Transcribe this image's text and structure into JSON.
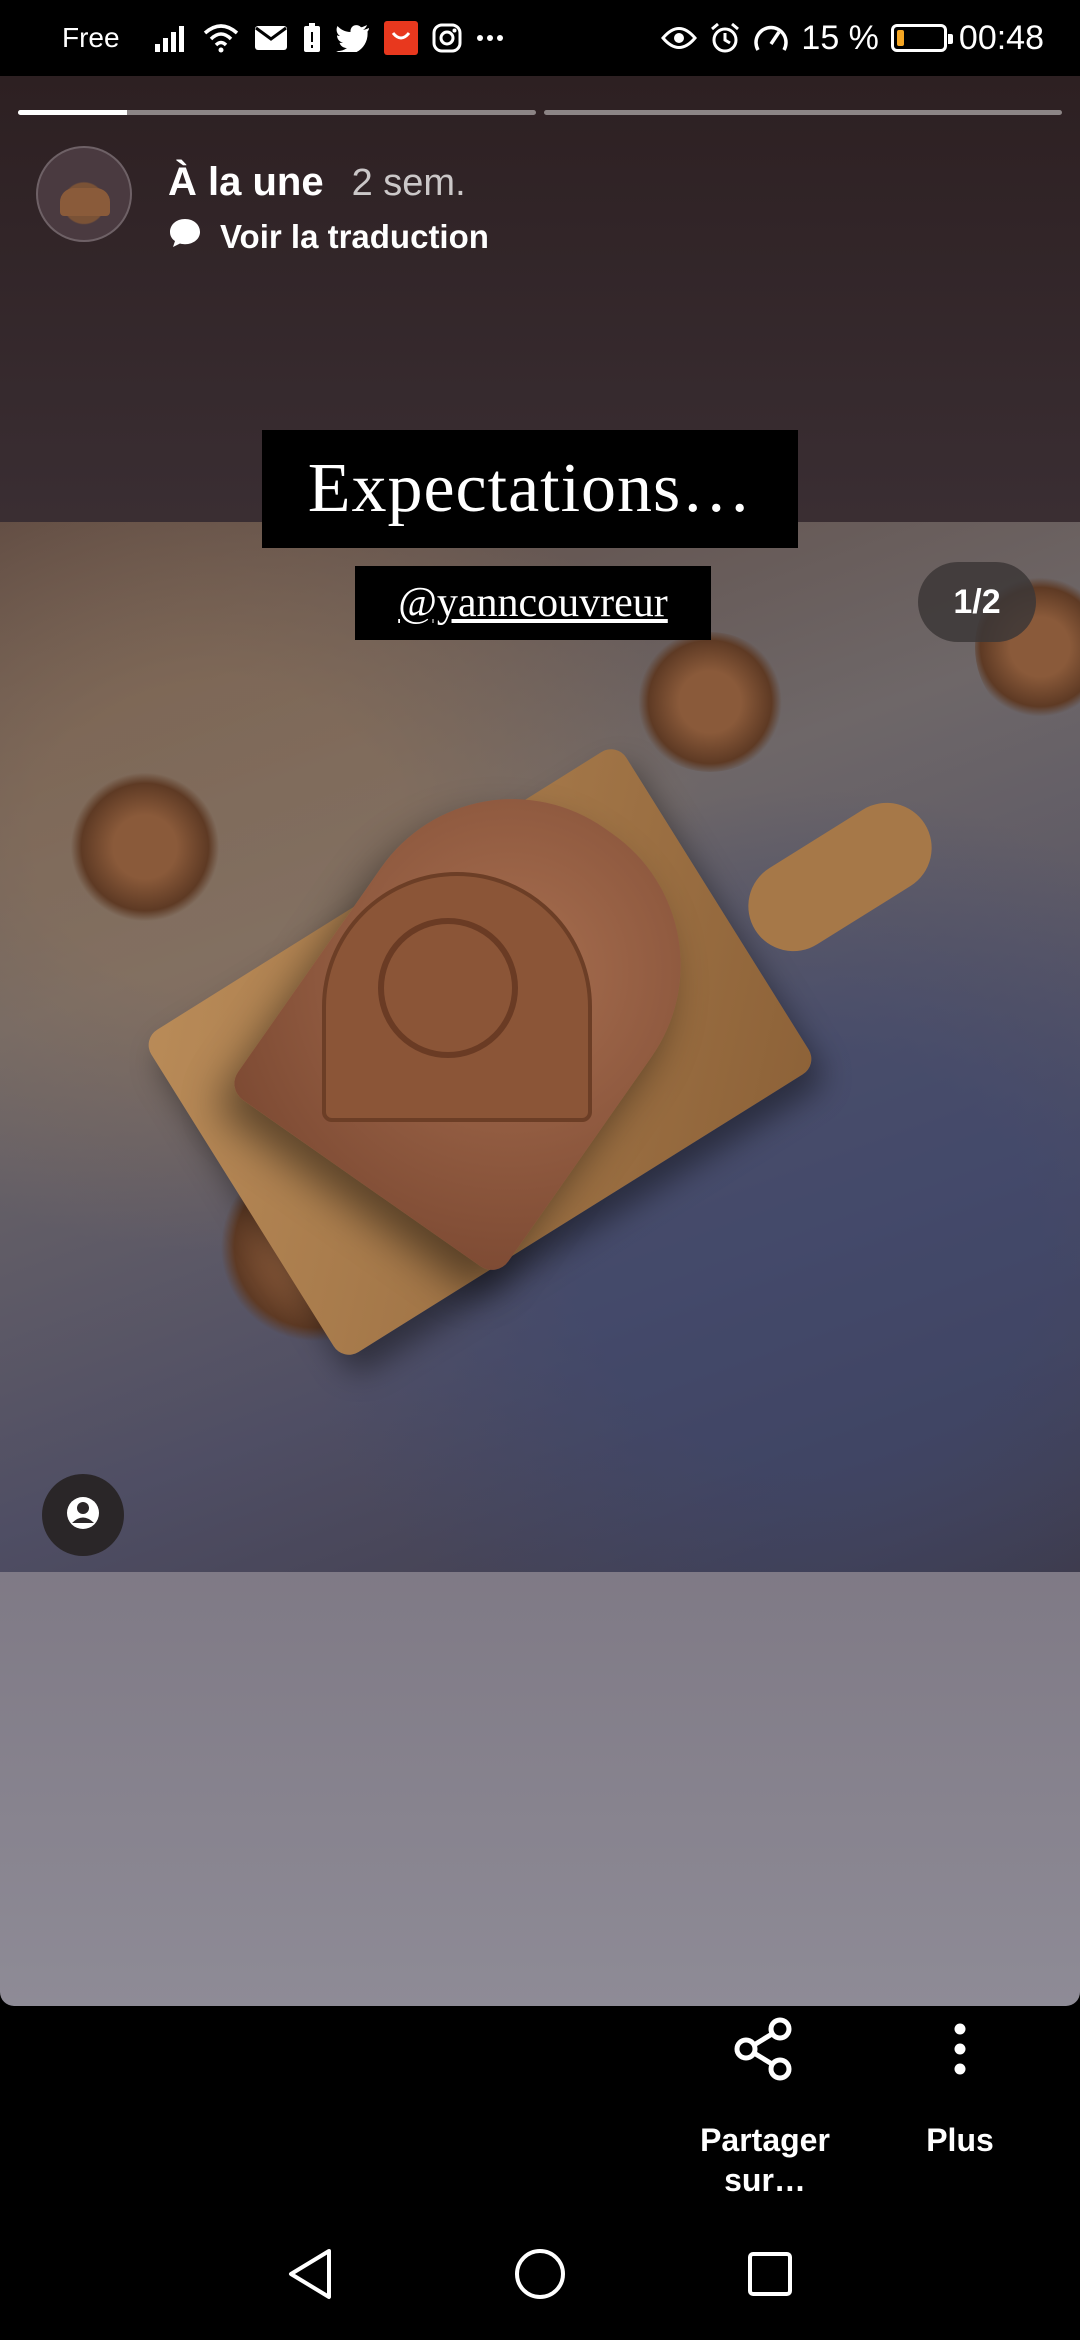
{
  "status_bar": {
    "carrier": "Free",
    "battery_percent": "15 %",
    "battery_level": 0.15,
    "time": "00:48",
    "icons": [
      "signal-icon",
      "wifi-icon",
      "mail-icon",
      "battery-alert-icon",
      "twitter-icon",
      "aliexpress-icon",
      "instagram-icon",
      "more-icon",
      "eye-icon",
      "alarm-icon",
      "speedometer-icon"
    ]
  },
  "story": {
    "progress": [
      0.21,
      0.0
    ],
    "title": "À la une",
    "time_ago": "2 sem.",
    "translate_label": "Voir la traduction",
    "caption": "Expectations…",
    "mention": "@yanncouvreur",
    "counter": "1/2"
  },
  "actions": {
    "share_label": "Partager sur…",
    "more_label": "Plus"
  },
  "nav": {
    "icons": [
      "back-icon",
      "home-icon",
      "recents-icon"
    ]
  }
}
